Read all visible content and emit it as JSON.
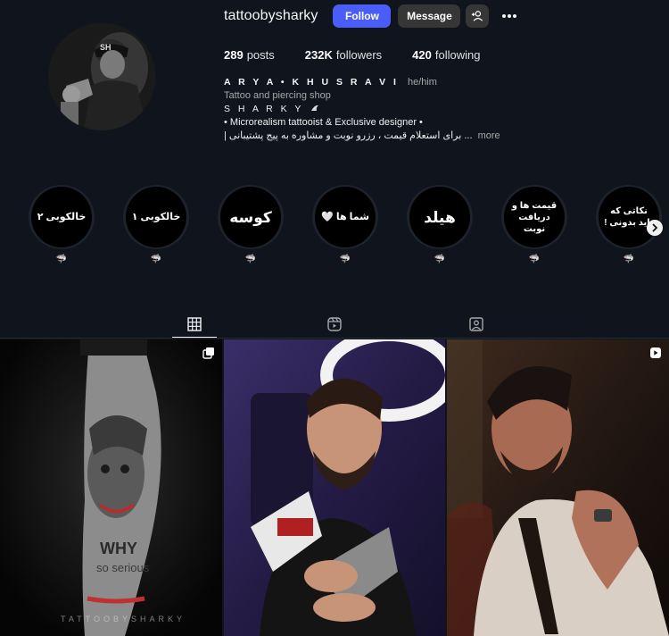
{
  "profile": {
    "username": "tattoobysharky",
    "follow_label": "Follow",
    "message_label": "Message",
    "stats": [
      {
        "count": "289",
        "label": "posts"
      },
      {
        "count": "232K",
        "label": "followers"
      },
      {
        "count": "420",
        "label": "following"
      }
    ],
    "display_name": "A R Y A • K H U S R A V I",
    "pronouns": "he/him",
    "category": "Tattoo and piercing shop",
    "brand_line": "S H A R K Y",
    "bio_line_1": "• Microrealism tattooist & Exclusive designer •",
    "bio_line_2": "برای استعلام قیمت ، رزرو نوبت و مشاوره به پیج پشتیبانی |",
    "bio_line_2_ellipsis": "...",
    "more_label": "more"
  },
  "highlights": [
    {
      "title": "خالکوبی ۲",
      "label": "🦈"
    },
    {
      "title": "خالکوبی ۱",
      "label": "🦈"
    },
    {
      "title": "کوسه",
      "label": "🦈"
    },
    {
      "title": "شما ها 🤍",
      "label": "🦈"
    },
    {
      "title": "هیلد",
      "label": "🦈"
    },
    {
      "title": "قیمت ها و دریافت نوبت",
      "label": "🦈"
    },
    {
      "title": "نکاتی که باید بدونی !",
      "label": "🦈"
    }
  ],
  "tabs": [
    {
      "name": "posts-grid-icon",
      "active": true
    },
    {
      "name": "reels-icon",
      "active": false
    },
    {
      "name": "tagged-icon",
      "active": false
    }
  ],
  "posts": [
    {
      "badge": "carousel-icon",
      "watermark": "TATTOOBYSHARKY"
    },
    {
      "badge": "",
      "watermark": ""
    },
    {
      "badge": "reel-icon",
      "watermark": ""
    }
  ],
  "colors": {
    "background": "#0f141d",
    "follow_button": "#4a5df9",
    "secondary_button": "#363636"
  }
}
